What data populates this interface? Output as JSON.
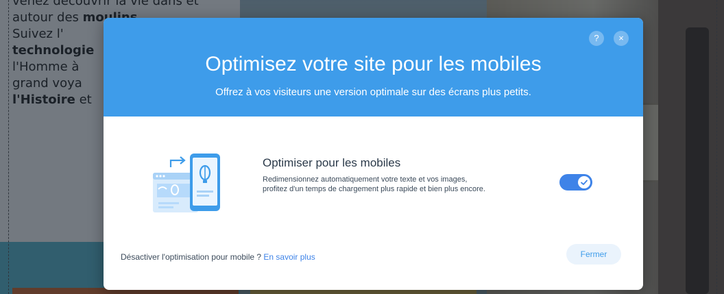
{
  "background": {
    "text_lines": [
      {
        "parts": [
          {
            "text": "venez découvrir la vie dans et",
            "bold": false
          }
        ]
      },
      {
        "parts": [
          {
            "text": "autour des ",
            "bold": false
          },
          {
            "text": "moulins",
            "bold": true
          }
        ]
      },
      {
        "parts": [
          {
            "text": "Suivez l'",
            "bold": false
          }
        ]
      },
      {
        "parts": [
          {
            "text": "technologie",
            "bold": true
          }
        ]
      },
      {
        "parts": [
          {
            "text": "l'Homme à",
            "bold": false
          }
        ]
      },
      {
        "parts": [
          {
            "text": "grand voya",
            "bold": false
          }
        ]
      },
      {
        "parts": [
          {
            "text": "l'Histoire",
            "bold": true
          },
          {
            "text": " et",
            "bold": false
          }
        ]
      }
    ]
  },
  "modal": {
    "title": "Optimisez votre site pour les mobiles",
    "subtitle": "Offrez à vos visiteurs une version optimale sur des écrans plus petits.",
    "help_label": "?",
    "close_label": "×",
    "option": {
      "title": "Optimiser pour les mobiles",
      "description": "Redimensionnez automatiquement votre texte et vos images, profitez d'un temps de chargement plus rapide et bien plus encore.",
      "enabled": true
    },
    "footer": {
      "question": "Désactiver l'optimisation pour mobile ? ",
      "link": "En savoir plus"
    },
    "close_button": "Fermer"
  },
  "colors": {
    "header_blue": "#3e9cea",
    "toggle_on": "#3e83e8",
    "overlay": "rgba(22,33,45,0.58)"
  },
  "icons": {
    "help": "question-mark-icon",
    "close": "close-icon",
    "illustration": "mobile-desktop-illustration",
    "toggle_check": "checkmark-icon"
  }
}
